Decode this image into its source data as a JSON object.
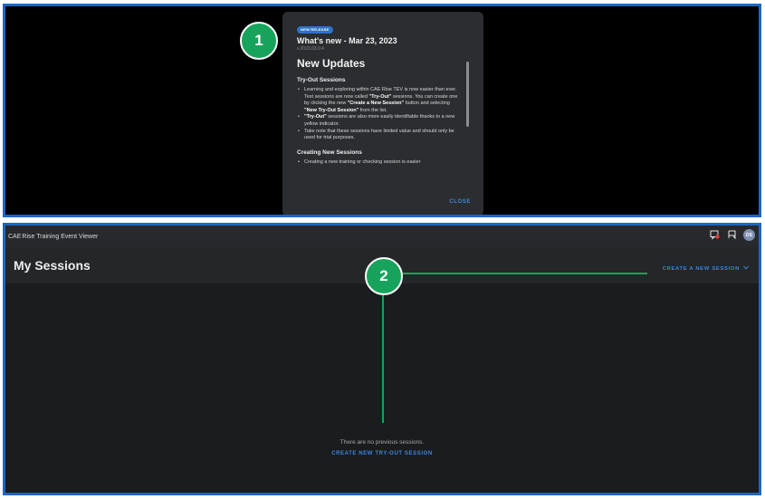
{
  "release_dialog": {
    "badge": "NEW RELEASE",
    "title": "What's new - Mar 23, 2023",
    "version": "v.2023.03.0.4",
    "heading": "New Updates",
    "section1_title": "Try-Out Sessions",
    "b1_pre": "Learning and exploring within CAE Rise TEV is now easier than ever. Test sessions are now called ",
    "b1_bold1": "\"Try-Out\"",
    "b1_mid": " sessions. You can create one by clicking the new ",
    "b1_bold2": "\"Create a New Session\"",
    "b1_mid2": " button and selecting ",
    "b1_bold3": "\"New Try-Out Session\"",
    "b1_post": " from the list.",
    "b2_bold": "\"Try-Out\"",
    "b2_post": " sessions are also more easily identifiable thanks to a new yellow indicator.",
    "b3": "Take note that these sessions have limited value and should only be used for trial purposes.",
    "section2_title": "Creating New Sessions",
    "b4": "Creating a new training or checking session is easier",
    "close_label": "CLOSE"
  },
  "markers": {
    "m1": "1",
    "m2": "2"
  },
  "app": {
    "brand": "CAE",
    "title": "Rise Training Event Viewer",
    "avatar_initials": "DS",
    "page_title": "My Sessions",
    "create_button": "CREATE A NEW SESSION",
    "empty_text": "There are no previous sessions.",
    "empty_link": "CREATE NEW TRY-OUT SESSION"
  },
  "icons": {
    "titlebar": [
      "notification-icon",
      "chat-icon"
    ],
    "create_button": "chevron-down-icon"
  },
  "colors": {
    "frame": "#1f66c1",
    "marker": "#17a35b",
    "accent": "#3b85de"
  }
}
